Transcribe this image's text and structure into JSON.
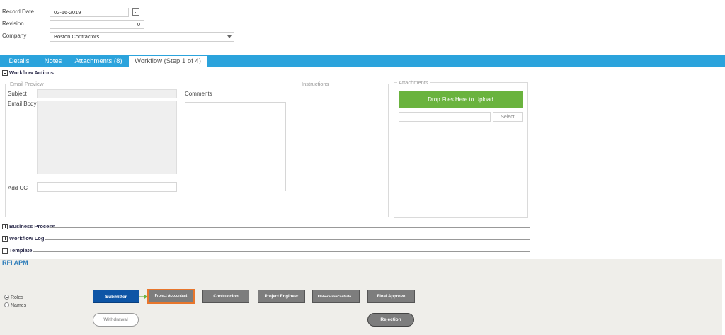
{
  "form": {
    "record_date_label": "Record Date",
    "record_date_value": "02-16-2019",
    "revision_label": "Revision",
    "revision_value": "0",
    "company_label": "Company",
    "company_value": "Boston Contractors"
  },
  "tabs": [
    {
      "label": "Details"
    },
    {
      "label": "Notes"
    },
    {
      "label": "Attachments (8)"
    },
    {
      "label": "Workflow (Step 1 of 4)"
    }
  ],
  "sections": {
    "workflow_actions": "Workflow Actions",
    "business_process": "Business Process",
    "workflow_log": "Workflow Log",
    "template": "Template"
  },
  "email_preview": {
    "legend": "Email Preview",
    "subject_label": "Subject",
    "body_label": "Email Body",
    "cc_label": "Add CC",
    "comments_label": "Comments"
  },
  "instructions": {
    "legend": "Instructions"
  },
  "attachments": {
    "legend": "Attachments",
    "upload_label": "Drop Files Here to Upload",
    "select_label": "Select"
  },
  "template": {
    "title": "RFI APM",
    "radio_roles": "Roles",
    "radio_names": "Names",
    "steps": [
      {
        "label": "Submitter"
      },
      {
        "label": "Project Accountant"
      },
      {
        "label": "Contruccion"
      },
      {
        "label": "Project Engineer"
      },
      {
        "label": "ElaboracionContrato..."
      },
      {
        "label": "Final Approve"
      }
    ],
    "withdrawal_label": "Withdrawal",
    "rejection_label": "Rejection"
  },
  "colors": {
    "tab_bar": "#2ba3dc",
    "upload_button": "#6ab33e",
    "submitter_step": "#0e55a6",
    "selected_step_border": "#e8762c",
    "arrow": "#6ab33e"
  }
}
